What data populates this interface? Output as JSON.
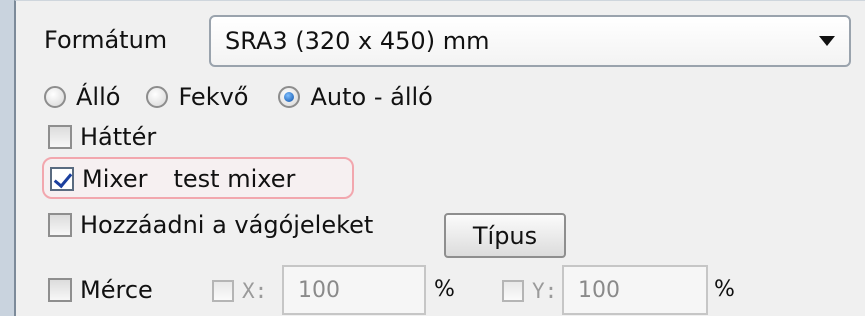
{
  "format": {
    "label": "Formátum",
    "selected": "SRA3 (320 x 450) mm"
  },
  "orientation": [
    {
      "label": "Álló",
      "checked": false
    },
    {
      "label": "Fekvő",
      "checked": false
    },
    {
      "label": "Auto - álló",
      "checked": true
    }
  ],
  "background": {
    "label": "Háttér",
    "checked": false
  },
  "mixer": {
    "label": "Mixer",
    "value": "test mixer",
    "checked": true
  },
  "cutmarks": {
    "label": "Hozzáadni a vágójeleket",
    "checked": false,
    "type_button": "Típus"
  },
  "scale": {
    "label": "Mérce",
    "checked": false,
    "x_label": "X:",
    "x_value": "100",
    "y_label": "Y:",
    "y_value": "100",
    "unit": "%"
  }
}
